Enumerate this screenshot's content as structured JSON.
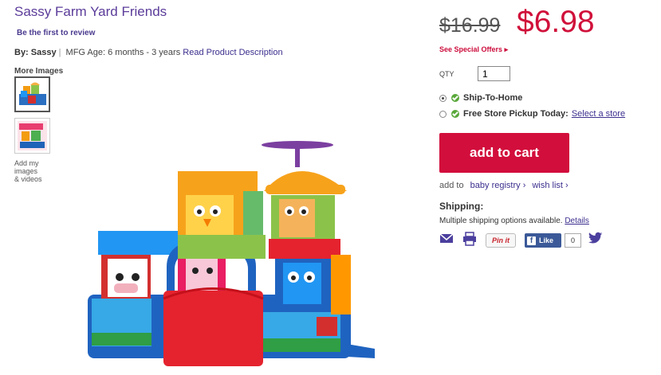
{
  "product": {
    "title": "Sassy Farm Yard Friends",
    "review_link": "Be the first to review",
    "by_label": "By:",
    "brand": "Sassy",
    "separator": "|",
    "mfg_age": "MFG Age: 6 months - 3 years",
    "read_description": "Read Product Description"
  },
  "gallery": {
    "more_images_label": "More Images",
    "add_images_line1": "Add my",
    "add_images_line2": "images",
    "add_images_line3": "& videos"
  },
  "pricing": {
    "old_price": "$16.99",
    "new_price": "$6.98",
    "special_offers": "See Special Offers",
    "special_offers_arrow": "▸"
  },
  "quantity": {
    "label": "QTY",
    "value": "1"
  },
  "fulfillment": {
    "ship_to_home": "Ship-To-Home",
    "store_pickup": "Free Store Pickup Today:",
    "select_store": "Select a store",
    "selected": "ship_to_home"
  },
  "cart": {
    "add_to_cart": "add to cart",
    "add_to_label": "add to",
    "baby_registry": "baby registry",
    "wish_list": "wish list",
    "arrow": "›"
  },
  "shipping": {
    "heading": "Shipping:",
    "text": "Multiple shipping options available.",
    "details": "Details"
  },
  "social": {
    "pin_it": "Pin it",
    "fb_f": "f",
    "like": "Like",
    "like_count": "0"
  },
  "colors": {
    "brand_purple": "#5b3c9a",
    "price_red": "#d0103a",
    "cart_red": "#d20e3c",
    "link_purple": "#3b2f8e",
    "check_green": "#5aa83a",
    "facebook_blue": "#3b5998"
  }
}
